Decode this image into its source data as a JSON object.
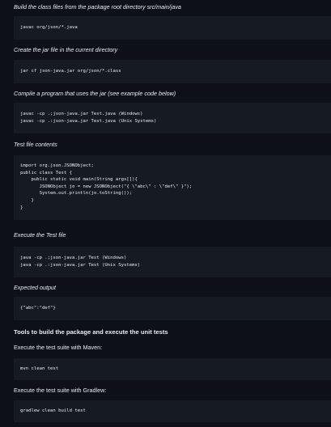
{
  "sections": [
    {
      "caption": "Build the class files from the package root directory src/main/java",
      "code": "javac org/json/*.java"
    },
    {
      "caption": "Create the jar file in the current directory",
      "code": "jar cf json-java.jar org/json/*.class"
    },
    {
      "caption": "Compile a program that uses the jar (see example code below)",
      "code": "javac -cp .;json-java.jar Test.java (Windows)\njavac -cp .:json-java.jar Test.java (Unix Systems)"
    },
    {
      "caption": "Test file contents",
      "code": "import org.json.JSONObject;\npublic class Test {\n    public static void main(String args[]){\n       JSONObject jo = new JSONObject(\"{ \\\"abc\\\" : \\\"def\\\" }\");\n       System.out.println(jo.toString());\n    }\n}"
    },
    {
      "caption": "Execute the Test file",
      "code": "java -cp .;json-java.jar Test (Windows)\njava -cp .:json-java.jar Test (Unix Systems)"
    },
    {
      "caption": "Expected output",
      "code": "{\"abc\":\"def\"}"
    }
  ],
  "tools": {
    "heading": "Tools to build the package and execute the unit tests",
    "maven_caption": "Execute the test suite with Maven:",
    "maven_code": "mvn clean test",
    "gradle_caption": "Execute the test suite with Gradlew:",
    "gradle_code": "gradlew clean build test"
  }
}
